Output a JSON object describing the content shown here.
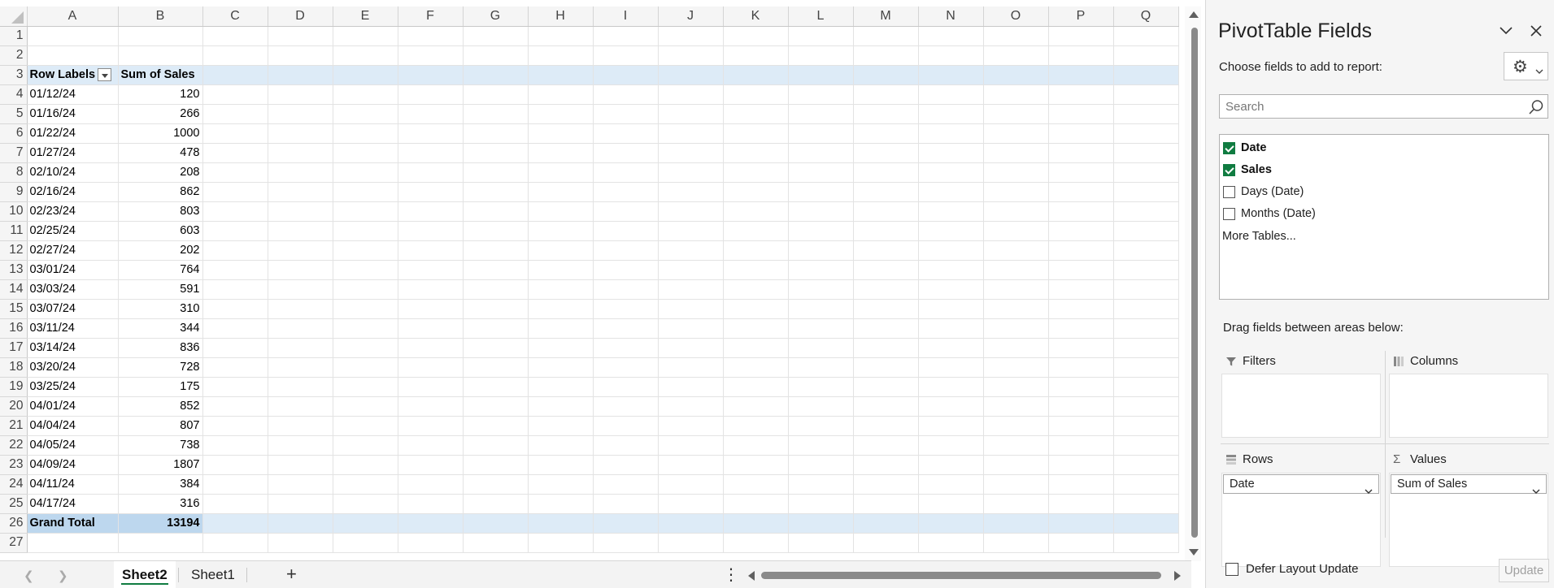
{
  "columns": [
    "A",
    "B",
    "C",
    "D",
    "E",
    "F",
    "G",
    "H",
    "I",
    "J",
    "K",
    "L",
    "M",
    "N",
    "O",
    "P",
    "Q"
  ],
  "pivot": {
    "header": {
      "row_labels": "Row Labels",
      "sum_label": "Sum of Sales"
    },
    "rows": [
      {
        "label": "01/12/24",
        "value": "120"
      },
      {
        "label": "01/16/24",
        "value": "266"
      },
      {
        "label": "01/22/24",
        "value": "1000"
      },
      {
        "label": "01/27/24",
        "value": "478"
      },
      {
        "label": "02/10/24",
        "value": "208"
      },
      {
        "label": "02/16/24",
        "value": "862"
      },
      {
        "label": "02/23/24",
        "value": "803"
      },
      {
        "label": "02/25/24",
        "value": "603"
      },
      {
        "label": "02/27/24",
        "value": "202"
      },
      {
        "label": "03/01/24",
        "value": "764"
      },
      {
        "label": "03/03/24",
        "value": "591"
      },
      {
        "label": "03/07/24",
        "value": "310"
      },
      {
        "label": "03/11/24",
        "value": "344"
      },
      {
        "label": "03/14/24",
        "value": "836"
      },
      {
        "label": "03/20/24",
        "value": "728"
      },
      {
        "label": "03/25/24",
        "value": "175"
      },
      {
        "label": "04/01/24",
        "value": "852"
      },
      {
        "label": "04/04/24",
        "value": "807"
      },
      {
        "label": "04/05/24",
        "value": "738"
      },
      {
        "label": "04/09/24",
        "value": "1807"
      },
      {
        "label": "04/11/24",
        "value": "384"
      },
      {
        "label": "04/17/24",
        "value": "316"
      }
    ],
    "grand_total": {
      "label": "Grand Total",
      "value": "13194"
    }
  },
  "sheet_tabs": {
    "active": "Sheet2",
    "other": "Sheet1",
    "add": "+"
  },
  "panel": {
    "title": "PivotTable Fields",
    "choose_label": "Choose fields to add to report:",
    "search_placeholder": "Search",
    "fields": [
      {
        "name": "Date",
        "checked": true
      },
      {
        "name": "Sales",
        "checked": true
      },
      {
        "name": "Days (Date)",
        "checked": false
      },
      {
        "name": "Months (Date)",
        "checked": false
      }
    ],
    "more_tables": "More Tables...",
    "drag_label": "Drag fields between areas below:",
    "areas": {
      "filters": "Filters",
      "columns": "Columns",
      "rows": "Rows",
      "values": "Values",
      "rows_field": "Date",
      "values_field": "Sum of Sales"
    },
    "defer_label": "Defer Layout Update",
    "update_label": "Update"
  },
  "colors": {
    "accent": "#107c41",
    "pivot_header": "#ddebf7",
    "pivot_total": "#bdd7ee"
  }
}
